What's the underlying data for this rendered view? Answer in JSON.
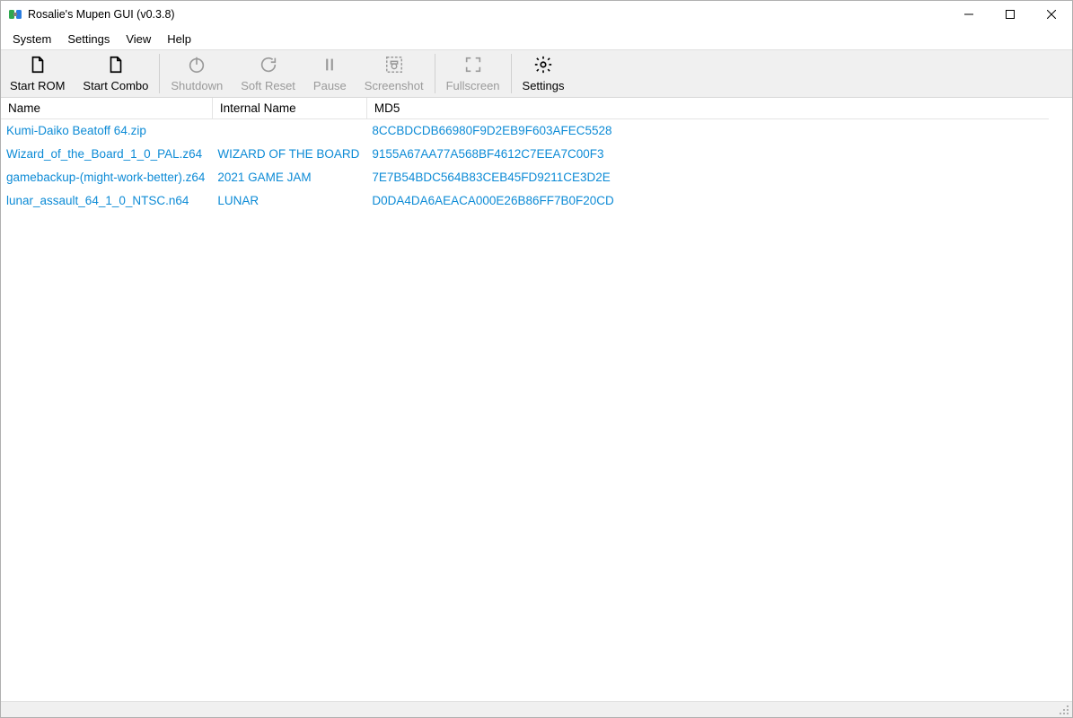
{
  "window": {
    "title": "Rosalie's Mupen GUI (v0.3.8)"
  },
  "menu": {
    "system": "System",
    "settings": "Settings",
    "view": "View",
    "help": "Help"
  },
  "toolbar": {
    "start_rom": {
      "label": "Start ROM",
      "enabled": true
    },
    "start_combo": {
      "label": "Start Combo",
      "enabled": true
    },
    "shutdown": {
      "label": "Shutdown",
      "enabled": false
    },
    "soft_reset": {
      "label": "Soft Reset",
      "enabled": false
    },
    "pause": {
      "label": "Pause",
      "enabled": false
    },
    "screenshot": {
      "label": "Screenshot",
      "enabled": false
    },
    "fullscreen": {
      "label": "Fullscreen",
      "enabled": false
    },
    "settings": {
      "label": "Settings",
      "enabled": true
    }
  },
  "columns": {
    "name": "Name",
    "internal_name": "Internal Name",
    "md5": "MD5"
  },
  "rows": [
    {
      "name": "Kumi-Daiko Beatoff 64.zip",
      "internal_name": "",
      "md5": "8CCBDCDB66980F9D2EB9F603AFEC5528"
    },
    {
      "name": "Wizard_of_the_Board_1_0_PAL.z64",
      "internal_name": "WIZARD OF THE BOARD",
      "md5": "9155A67AA77A568BF4612C7EEA7C00F3"
    },
    {
      "name": "gamebackup-(might-work-better).z64",
      "internal_name": "2021 GAME JAM",
      "md5": "7E7B54BDC564B83CEB45FD9211CE3D2E"
    },
    {
      "name": "lunar_assault_64_1_0_NTSC.n64",
      "internal_name": "LUNAR",
      "md5": "D0DA4DA6AEACA000E26B86FF7B0F20CD"
    }
  ],
  "colors": {
    "link": "#0d8bd6",
    "toolbar_bg": "#f0f0f0"
  }
}
